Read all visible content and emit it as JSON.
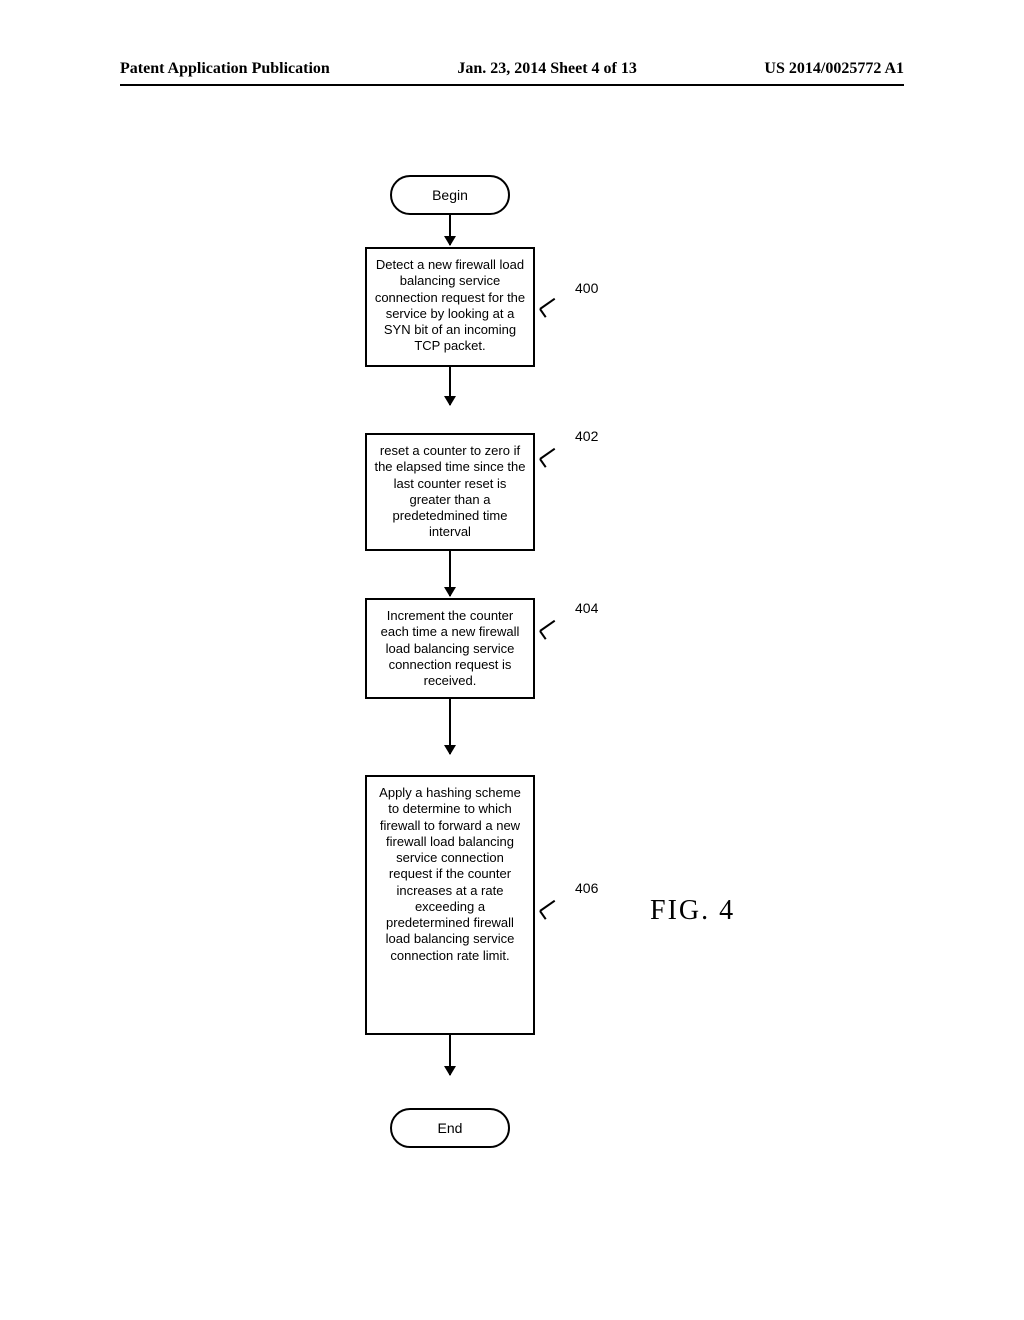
{
  "header": {
    "left": "Patent Application Publication",
    "center": "Jan. 23, 2014  Sheet 4 of 13",
    "right": "US 2014/0025772 A1"
  },
  "terminators": {
    "begin": "Begin",
    "end": "End"
  },
  "steps": {
    "s400": {
      "text": "Detect a new firewall load balancing service connection request for the service by looking at a SYN bit of an incoming TCP packet.",
      "ref": "400"
    },
    "s402": {
      "text": "reset a counter to zero if the elapsed time since the last counter reset is greater than a predetedmined time interval",
      "ref": "402"
    },
    "s404": {
      "text": "Increment the counter each time a new firewall load balancing service connection request is received.",
      "ref": "404"
    },
    "s406": {
      "text": "Apply a hashing scheme to determine to which firewall to forward a new firewall load balancing service connection request if the counter increases at a rate exceeding a predetermined firewall load balancing service connection rate limit.",
      "ref": "406"
    }
  },
  "figure_label": "FIG. 4"
}
